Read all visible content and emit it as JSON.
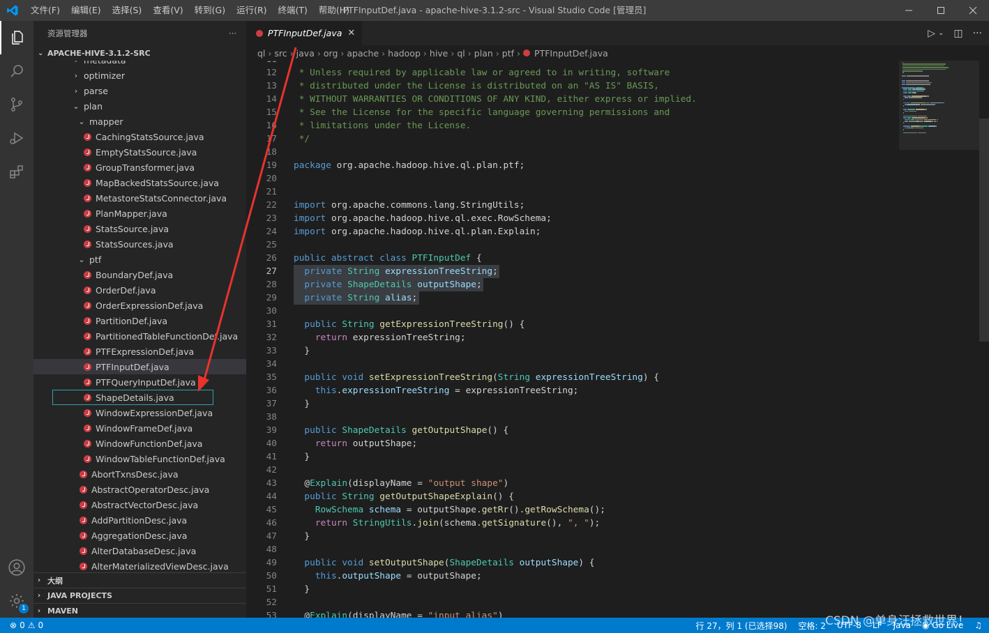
{
  "app": {
    "window_title": "PTFInputDef.java - apache-hive-3.1.2-src - Visual Studio Code [管理员]",
    "menu": [
      "文件(F)",
      "编辑(E)",
      "选择(S)",
      "查看(V)",
      "转到(G)",
      "运行(R)",
      "终端(T)",
      "帮助(H)"
    ],
    "brand_color": "#007acc"
  },
  "activity_bar": {
    "icons": [
      "explorer-icon",
      "search-icon",
      "source-control-icon",
      "run-debug-icon",
      "extensions-icon"
    ],
    "bottom_icons": [
      "accounts-icon",
      "manage-gear-icon"
    ],
    "badge": "1"
  },
  "sidebar": {
    "title": "资源管理器",
    "more": "···",
    "root": "APACHE-HIVE-3.1.2-SRC",
    "tree": [
      {
        "label": "metadata",
        "type": "folder",
        "depth": 2,
        "state": "closed"
      },
      {
        "label": "optimizer",
        "type": "folder",
        "depth": 2,
        "state": "closed"
      },
      {
        "label": "parse",
        "type": "folder",
        "depth": 2,
        "state": "closed"
      },
      {
        "label": "plan",
        "type": "folder",
        "depth": 2,
        "state": "open"
      },
      {
        "label": "mapper",
        "type": "folder",
        "depth": 3,
        "state": "open"
      },
      {
        "label": "CachingStatsSource.java",
        "type": "java",
        "depth": 4
      },
      {
        "label": "EmptyStatsSource.java",
        "type": "java",
        "depth": 4
      },
      {
        "label": "GroupTransformer.java",
        "type": "java",
        "depth": 4
      },
      {
        "label": "MapBackedStatsSource.java",
        "type": "java",
        "depth": 4
      },
      {
        "label": "MetastoreStatsConnector.java",
        "type": "java",
        "depth": 4
      },
      {
        "label": "PlanMapper.java",
        "type": "java",
        "depth": 4
      },
      {
        "label": "StatsSource.java",
        "type": "java",
        "depth": 4
      },
      {
        "label": "StatsSources.java",
        "type": "java",
        "depth": 4
      },
      {
        "label": "ptf",
        "type": "folder",
        "depth": 3,
        "state": "open"
      },
      {
        "label": "BoundaryDef.java",
        "type": "java",
        "depth": 4
      },
      {
        "label": "OrderDef.java",
        "type": "java",
        "depth": 4
      },
      {
        "label": "OrderExpressionDef.java",
        "type": "java",
        "depth": 4
      },
      {
        "label": "PartitionDef.java",
        "type": "java",
        "depth": 4
      },
      {
        "label": "PartitionedTableFunctionDef.java",
        "type": "java",
        "depth": 4
      },
      {
        "label": "PTFExpressionDef.java",
        "type": "java",
        "depth": 4
      },
      {
        "label": "PTFInputDef.java",
        "type": "java",
        "depth": 4,
        "selected": true
      },
      {
        "label": "PTFQueryInputDef.java",
        "type": "java",
        "depth": 4
      },
      {
        "label": "ShapeDetails.java",
        "type": "java",
        "depth": 4,
        "focused": true
      },
      {
        "label": "WindowExpressionDef.java",
        "type": "java",
        "depth": 4
      },
      {
        "label": "WindowFrameDef.java",
        "type": "java",
        "depth": 4
      },
      {
        "label": "WindowFunctionDef.java",
        "type": "java",
        "depth": 4
      },
      {
        "label": "WindowTableFunctionDef.java",
        "type": "java",
        "depth": 4
      },
      {
        "label": "AbortTxnsDesc.java",
        "type": "java",
        "depth": 3
      },
      {
        "label": "AbstractOperatorDesc.java",
        "type": "java",
        "depth": 3
      },
      {
        "label": "AbstractVectorDesc.java",
        "type": "java",
        "depth": 3
      },
      {
        "label": "AddPartitionDesc.java",
        "type": "java",
        "depth": 3
      },
      {
        "label": "AggregationDesc.java",
        "type": "java",
        "depth": 3
      },
      {
        "label": "AlterDatabaseDesc.java",
        "type": "java",
        "depth": 3
      },
      {
        "label": "AlterMaterializedViewDesc.java",
        "type": "java",
        "depth": 3
      }
    ],
    "sections": [
      "大纲",
      "JAVA PROJECTS",
      "MAVEN"
    ]
  },
  "editor": {
    "tab_label": "PTFInputDef.java",
    "close_glyph": "✕",
    "breadcrumb": [
      "ql",
      "src",
      "java",
      "org",
      "apache",
      "hadoop",
      "hive",
      "ql",
      "plan",
      "ptf",
      "PTFInputDef.java"
    ],
    "current_line": 27,
    "selected_lines": [
      27,
      28,
      29
    ],
    "first_line": 11,
    "lines": [
      [
        [
          "c",
          " * "
        ]
      ],
      [
        [
          "c",
          " * Unless required by applicable law or agreed to in writing, software"
        ]
      ],
      [
        [
          "c",
          " * distributed under the License is distributed on an \"AS IS\" BASIS,"
        ]
      ],
      [
        [
          "c",
          " * WITHOUT WARRANTIES OR CONDITIONS OF ANY KIND, either express or implied."
        ]
      ],
      [
        [
          "c",
          " * See the License for the specific language governing permissions and"
        ]
      ],
      [
        [
          "c",
          " * limitations under the License."
        ]
      ],
      [
        [
          "c",
          " */"
        ]
      ],
      [],
      [
        [
          "k",
          "package "
        ],
        [
          "p",
          "org.apache.hadoop.hive.ql.plan.ptf;"
        ]
      ],
      [],
      [],
      [
        [
          "k",
          "import "
        ],
        [
          "p",
          "org.apache.commons.lang.StringUtils;"
        ]
      ],
      [
        [
          "k",
          "import "
        ],
        [
          "p",
          "org.apache.hadoop.hive.ql.exec.RowSchema;"
        ]
      ],
      [
        [
          "k",
          "import "
        ],
        [
          "p",
          "org.apache.hadoop.hive.ql.plan.Explain;"
        ]
      ],
      [],
      [
        [
          "k",
          "public abstract class "
        ],
        [
          "t",
          "PTFInputDef"
        ],
        [
          "p",
          " {"
        ]
      ],
      [
        [
          "p",
          "  "
        ],
        [
          "k",
          "private "
        ],
        [
          "t",
          "String "
        ],
        [
          "v",
          "expressionTreeString"
        ],
        [
          "p",
          ";"
        ]
      ],
      [
        [
          "p",
          "  "
        ],
        [
          "k",
          "private "
        ],
        [
          "t",
          "ShapeDetails "
        ],
        [
          "v",
          "outputShape"
        ],
        [
          "p",
          ";"
        ]
      ],
      [
        [
          "p",
          "  "
        ],
        [
          "k",
          "private "
        ],
        [
          "t",
          "String "
        ],
        [
          "v",
          "alias"
        ],
        [
          "p",
          ";"
        ]
      ],
      [],
      [
        [
          "p",
          "  "
        ],
        [
          "k",
          "public "
        ],
        [
          "t",
          "String "
        ],
        [
          "f",
          "getExpressionTreeString"
        ],
        [
          "p",
          "() {"
        ]
      ],
      [
        [
          "p",
          "    "
        ],
        [
          "kc",
          "return "
        ],
        [
          "p",
          "expressionTreeString;"
        ]
      ],
      [
        [
          "p",
          "  }"
        ]
      ],
      [],
      [
        [
          "p",
          "  "
        ],
        [
          "k",
          "public void "
        ],
        [
          "f",
          "setExpressionTreeString"
        ],
        [
          "p",
          "("
        ],
        [
          "t",
          "String "
        ],
        [
          "v",
          "expressionTreeString"
        ],
        [
          "p",
          ") {"
        ]
      ],
      [
        [
          "p",
          "    "
        ],
        [
          "k",
          "this"
        ],
        [
          "p",
          "."
        ],
        [
          "v",
          "expressionTreeString"
        ],
        [
          "p",
          " = expressionTreeString;"
        ]
      ],
      [
        [
          "p",
          "  }"
        ]
      ],
      [],
      [
        [
          "p",
          "  "
        ],
        [
          "k",
          "public "
        ],
        [
          "t",
          "ShapeDetails "
        ],
        [
          "f",
          "getOutputShape"
        ],
        [
          "p",
          "() {"
        ]
      ],
      [
        [
          "p",
          "    "
        ],
        [
          "kc",
          "return "
        ],
        [
          "p",
          "outputShape;"
        ]
      ],
      [
        [
          "p",
          "  }"
        ]
      ],
      [],
      [
        [
          "p",
          "  @"
        ],
        [
          "t",
          "Explain"
        ],
        [
          "p",
          "(displayName = "
        ],
        [
          "s",
          "\"output shape\""
        ],
        [
          "p",
          ")"
        ]
      ],
      [
        [
          "p",
          "  "
        ],
        [
          "k",
          "public "
        ],
        [
          "t",
          "String "
        ],
        [
          "f",
          "getOutputShapeExplain"
        ],
        [
          "p",
          "() {"
        ]
      ],
      [
        [
          "p",
          "    "
        ],
        [
          "t",
          "RowSchema "
        ],
        [
          "v",
          "schema"
        ],
        [
          "p",
          " = outputShape."
        ],
        [
          "f",
          "getRr"
        ],
        [
          "p",
          "()."
        ],
        [
          "f",
          "getRowSchema"
        ],
        [
          "p",
          "();"
        ]
      ],
      [
        [
          "p",
          "    "
        ],
        [
          "kc",
          "return "
        ],
        [
          "t",
          "StringUtils"
        ],
        [
          "p",
          "."
        ],
        [
          "f",
          "join"
        ],
        [
          "p",
          "(schema."
        ],
        [
          "f",
          "getSignature"
        ],
        [
          "p",
          "(), "
        ],
        [
          "s",
          "\", \""
        ],
        [
          "p",
          ");"
        ]
      ],
      [
        [
          "p",
          "  }"
        ]
      ],
      [],
      [
        [
          "p",
          "  "
        ],
        [
          "k",
          "public void "
        ],
        [
          "f",
          "setOutputShape"
        ],
        [
          "p",
          "("
        ],
        [
          "t",
          "ShapeDetails "
        ],
        [
          "v",
          "outputShape"
        ],
        [
          "p",
          ") {"
        ]
      ],
      [
        [
          "p",
          "    "
        ],
        [
          "k",
          "this"
        ],
        [
          "p",
          "."
        ],
        [
          "v",
          "outputShape"
        ],
        [
          "p",
          " = outputShape;"
        ]
      ],
      [
        [
          "p",
          "  }"
        ]
      ],
      [],
      [
        [
          "p",
          "  @"
        ],
        [
          "t",
          "Explain"
        ],
        [
          "p",
          "(displayName = "
        ],
        [
          "s",
          "\"input alias\""
        ],
        [
          "p",
          ")"
        ]
      ]
    ]
  },
  "statusbar": {
    "errors": "0",
    "warnings": "0",
    "position": "行 27，列 1 (已选择98)",
    "spaces": "空格: 2",
    "encoding": "UTF-8",
    "eol": "LF",
    "language": "Java",
    "golive": "Go Live"
  },
  "watermark": "CSDN @单身汪拯救世界！"
}
